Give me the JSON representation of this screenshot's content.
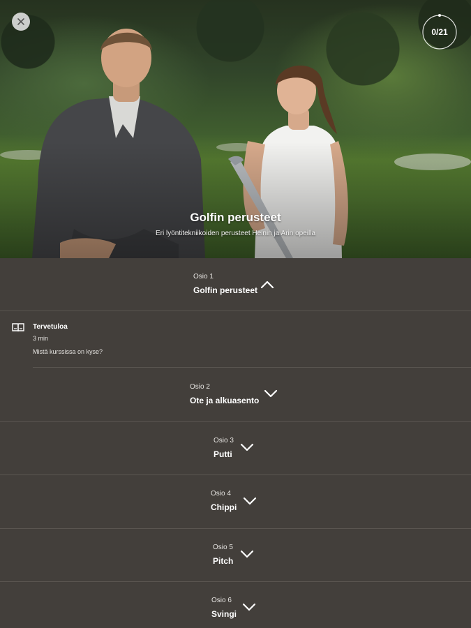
{
  "header": {
    "progress": "0/21",
    "progress_fraction": 0.0,
    "title": "Golfin perusteet",
    "subtitle": "Eri lyöntitekniikoiden perusteet Heinin ja Arin opeilla"
  },
  "sections": [
    {
      "kicker": "Osio 1",
      "name": "Golfin perusteet",
      "expanded": true,
      "chevron": "chevron-up-icon"
    },
    {
      "kicker": "Osio 2",
      "name": "Ote ja alkuasento",
      "expanded": false,
      "chevron": "chevron-down-icon"
    },
    {
      "kicker": "Osio 3",
      "name": "Putti",
      "expanded": false,
      "chevron": "chevron-down-icon"
    },
    {
      "kicker": "Osio 4",
      "name": "Chippi",
      "expanded": false,
      "chevron": "chevron-down-icon"
    },
    {
      "kicker": "Osio 5",
      "name": "Pitch",
      "expanded": false,
      "chevron": "chevron-down-icon"
    },
    {
      "kicker": "Osio 6",
      "name": "Svingi",
      "expanded": false,
      "chevron": "chevron-down-icon"
    }
  ],
  "lesson": {
    "icon": "book-icon",
    "title": "Tervetuloa",
    "duration": "3 min",
    "description": "Mistä kurssissa on kyse?"
  },
  "colors": {
    "background": "#433f3b",
    "divider": "#5a5550",
    "text": "#ffffff"
  }
}
